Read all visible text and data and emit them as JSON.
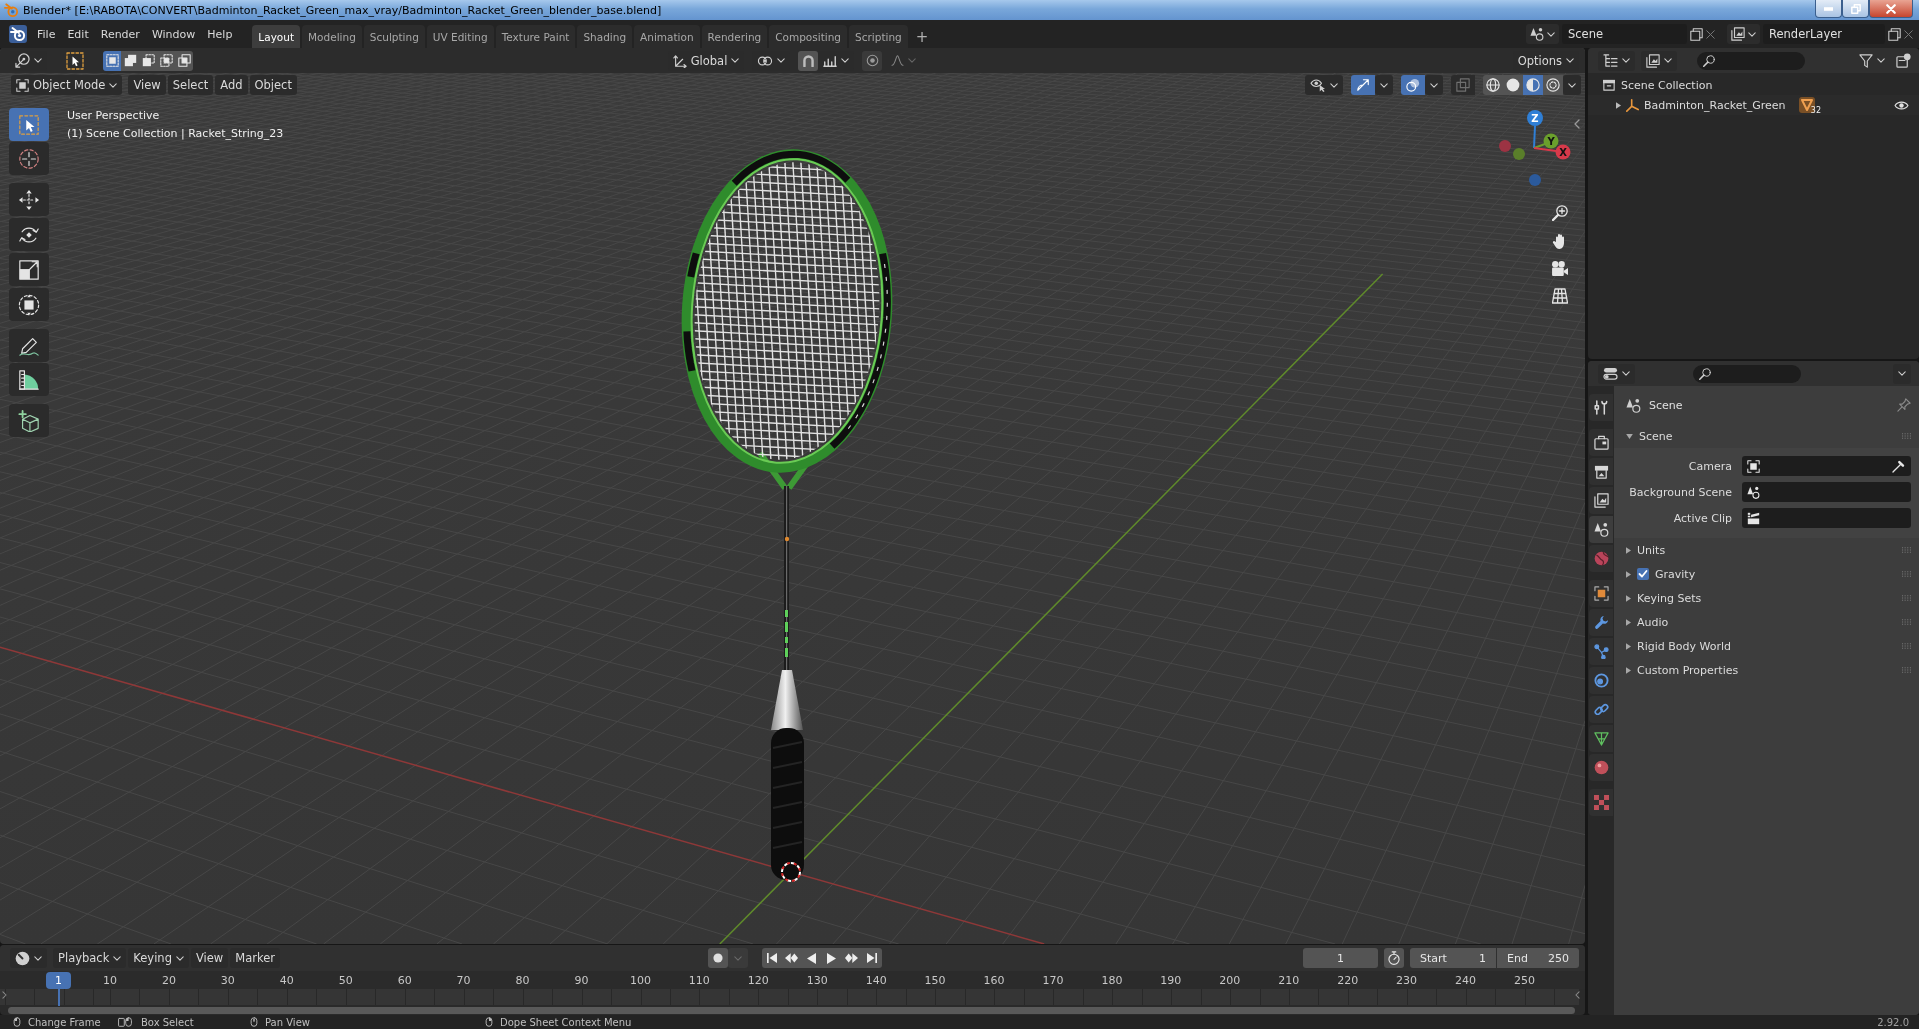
{
  "window": {
    "title": "Blender* [E:\\RABOTA\\CONVERT\\Badminton_Racket_Green_max_vray/Badminton_Racket_Green_blender_base.blend]"
  },
  "top_bar": {
    "menus": [
      "File",
      "Edit",
      "Render",
      "Window",
      "Help"
    ],
    "workspaces": [
      {
        "label": "Layout",
        "selected": true
      },
      {
        "label": "Modeling",
        "selected": false
      },
      {
        "label": "Sculpting",
        "selected": false
      },
      {
        "label": "UV Editing",
        "selected": false
      },
      {
        "label": "Texture Paint",
        "selected": false
      },
      {
        "label": "Shading",
        "selected": false
      },
      {
        "label": "Animation",
        "selected": false
      },
      {
        "label": "Rendering",
        "selected": false
      },
      {
        "label": "Compositing",
        "selected": false
      },
      {
        "label": "Scripting",
        "selected": false
      }
    ],
    "add_workspace": "+",
    "scene": "Scene",
    "view_layer": "RenderLayer"
  },
  "viewport": {
    "tool_settings": {
      "select_modes": [
        {
          "kind": "set",
          "selected": true
        },
        {
          "kind": "extend",
          "selected": false
        },
        {
          "kind": "subtract",
          "selected": false
        },
        {
          "kind": "difference",
          "selected": false
        },
        {
          "kind": "intersect",
          "selected": false
        }
      ],
      "orientation": "Global",
      "options": "Options"
    },
    "header": {
      "mode": "Object Mode",
      "menus": [
        "View",
        "Select",
        "Add",
        "Object"
      ],
      "toggles": [
        {
          "kind": "gizmos",
          "on": true
        },
        {
          "kind": "overlays",
          "on": true
        },
        {
          "kind": "xray",
          "on": false
        }
      ],
      "shading": [
        {
          "kind": "wireframe",
          "selected": false
        },
        {
          "kind": "solid",
          "selected": false
        },
        {
          "kind": "material",
          "selected": true
        },
        {
          "kind": "rendered",
          "selected": false
        }
      ]
    },
    "tools": [
      {
        "kind": "select_box",
        "selected": true
      },
      {
        "kind": "cursor",
        "selected": false
      },
      {
        "kind": "move",
        "selected": false
      },
      {
        "kind": "rotate",
        "selected": false
      },
      {
        "kind": "scale",
        "selected": false
      },
      {
        "kind": "transform",
        "selected": false
      },
      {
        "kind": "annotate",
        "selected": false
      },
      {
        "kind": "measure",
        "selected": false
      },
      {
        "kind": "add_cube",
        "selected": false
      }
    ],
    "view_name": "User Perspective",
    "info": "(1) Scene Collection | Racket_String_23",
    "gizmo": {
      "z": "Z",
      "y": "Y",
      "x": "X"
    }
  },
  "outliner": {
    "root": "Scene Collection",
    "items": [
      {
        "name": "Badminton_Racket_Green",
        "expanded": false,
        "count": "32",
        "visible": true
      }
    ]
  },
  "properties": {
    "tabs": [
      {
        "kind": "tool",
        "selected": false
      },
      {
        "kind": "render",
        "selected": false
      },
      {
        "kind": "output",
        "selected": false
      },
      {
        "kind": "view_layer",
        "selected": false
      },
      {
        "kind": "scene",
        "selected": true
      },
      {
        "kind": "world",
        "selected": false
      },
      {
        "kind": "object",
        "selected": false
      },
      {
        "kind": "modifiers",
        "selected": false
      },
      {
        "kind": "particles",
        "selected": false
      },
      {
        "kind": "physics",
        "selected": false
      },
      {
        "kind": "constraints",
        "selected": false
      },
      {
        "kind": "data",
        "selected": false
      },
      {
        "kind": "material",
        "selected": false
      },
      {
        "kind": "texture",
        "selected": false
      }
    ],
    "context": "Scene",
    "panels": [
      {
        "title": "Scene",
        "expanded": true,
        "fields": [
          {
            "label": "Camera",
            "kind": "camera"
          },
          {
            "label": "Background Scene",
            "kind": "scene"
          },
          {
            "label": "Active Clip",
            "kind": "clip"
          }
        ]
      },
      {
        "title": "Units",
        "expanded": false
      },
      {
        "title": "Gravity",
        "expanded": false,
        "checkbox": {
          "checked": true
        }
      },
      {
        "title": "Keying Sets",
        "expanded": false
      },
      {
        "title": "Audio",
        "expanded": false
      },
      {
        "title": "Rigid Body World",
        "expanded": false
      },
      {
        "title": "Custom Properties",
        "expanded": false
      }
    ]
  },
  "timeline": {
    "menus": [
      "Playback",
      "Keying",
      "View",
      "Marker"
    ],
    "auto_keying": false,
    "current_frame": "1",
    "start_label": "Start",
    "start": "1",
    "end_label": "End",
    "end": "250",
    "playhead": "1",
    "ticks": [
      "10",
      "20",
      "30",
      "40",
      "50",
      "60",
      "70",
      "80",
      "90",
      "100",
      "110",
      "120",
      "130",
      "140",
      "150",
      "160",
      "170",
      "180",
      "190",
      "200",
      "210",
      "220",
      "230",
      "240",
      "250"
    ]
  },
  "status_bar": {
    "items": [
      {
        "kind": "mouse_left",
        "label": "Change Frame"
      },
      {
        "kind": "mouse_box",
        "label": "Box Select"
      },
      {
        "kind": "mouse_middle",
        "label": "Pan View"
      },
      {
        "kind": "mouse_right",
        "label": "Dope Sheet Context Menu"
      }
    ],
    "version": "2.92.0"
  }
}
